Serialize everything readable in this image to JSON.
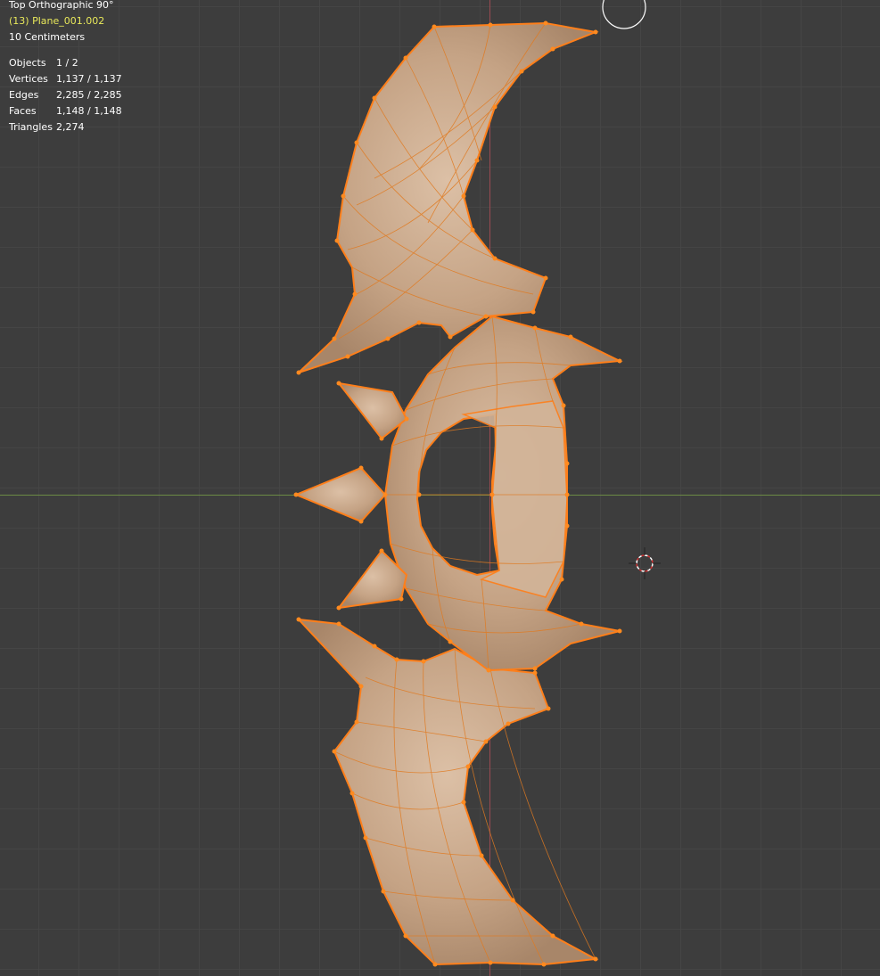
{
  "viewport": {
    "view_name": "Top Orthographic 90°",
    "active_object": "(13) Plane_001.002",
    "grid_scale": "10 Centimeters"
  },
  "stats": {
    "objects": {
      "label": "Objects",
      "value": "1 / 2"
    },
    "vertices": {
      "label": "Vertices",
      "value": "1,137 / 1,137"
    },
    "edges": {
      "label": "Edges",
      "value": "2,285 / 2,285"
    },
    "faces": {
      "label": "Faces",
      "value": "1,148 / 1,148"
    },
    "triangles": {
      "label": "Triangles",
      "value": "2,274"
    }
  },
  "colors": {
    "background": "#3d3d3d",
    "grid": "#474747",
    "x_axis": "#6b8a45",
    "y_axis": "#9a4a52",
    "mesh_fill": "#c9a98c",
    "selection": "#ff7f1a"
  },
  "icons": [
    "brush-circle-cursor-icon",
    "3d-cursor-icon"
  ]
}
